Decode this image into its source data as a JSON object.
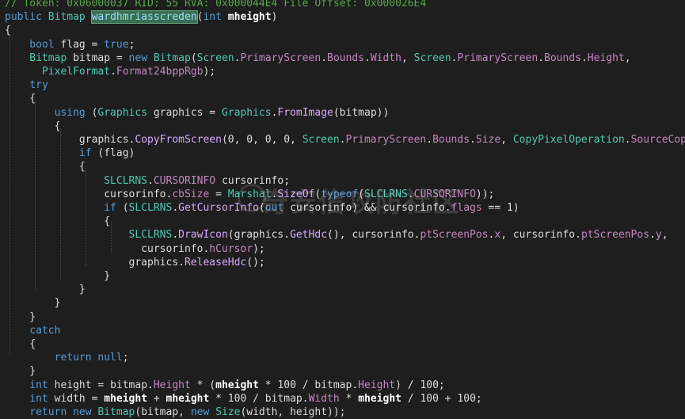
{
  "editor": {
    "lines": [
      [
        {
          "t": "// Token: 0x06000037 RID: 55 RVA: 0x000044E4 File Offset: 0x000026E4",
          "c": "cm"
        }
      ],
      [
        {
          "t": "public ",
          "c": "kw"
        },
        {
          "t": "Bitmap ",
          "c": "ty"
        },
        {
          "t": "wardhmriasscreden",
          "c": "hl"
        },
        {
          "t": "(",
          "c": "pl"
        },
        {
          "t": "int ",
          "c": "kw"
        },
        {
          "t": "mheight",
          "c": "bd"
        },
        {
          "t": ")",
          "c": "pl"
        }
      ],
      [
        {
          "t": "{",
          "c": "pl"
        }
      ],
      [
        {
          "t": "    bool ",
          "c": "kw"
        },
        {
          "t": "flag = ",
          "c": "pl"
        },
        {
          "t": "true",
          "c": "kw"
        },
        {
          "t": ";",
          "c": "pl"
        }
      ],
      [
        {
          "t": "    Bitmap ",
          "c": "ty"
        },
        {
          "t": "bitmap = ",
          "c": "pl"
        },
        {
          "t": "new ",
          "c": "kw"
        },
        {
          "t": "Bitmap",
          "c": "ty"
        },
        {
          "t": "(",
          "c": "pl"
        },
        {
          "t": "Screen",
          "c": "ty"
        },
        {
          "t": ".",
          "c": "pl"
        },
        {
          "t": "PrimaryScreen",
          "c": "pr"
        },
        {
          "t": ".",
          "c": "pl"
        },
        {
          "t": "Bounds",
          "c": "pr"
        },
        {
          "t": ".",
          "c": "pl"
        },
        {
          "t": "Width",
          "c": "pr"
        },
        {
          "t": ", ",
          "c": "pl"
        },
        {
          "t": "Screen",
          "c": "ty"
        },
        {
          "t": ".",
          "c": "pl"
        },
        {
          "t": "PrimaryScreen",
          "c": "pr"
        },
        {
          "t": ".",
          "c": "pl"
        },
        {
          "t": "Bounds",
          "c": "pr"
        },
        {
          "t": ".",
          "c": "pl"
        },
        {
          "t": "Height",
          "c": "pr"
        },
        {
          "t": ",",
          "c": "pl"
        }
      ],
      [
        {
          "t": "      PixelFormat",
          "c": "ty"
        },
        {
          "t": ".",
          "c": "pl"
        },
        {
          "t": "Format24bppRgb",
          "c": "pr"
        },
        {
          "t": ");",
          "c": "pl"
        }
      ],
      [
        {
          "t": "    try",
          "c": "kw"
        }
      ],
      [
        {
          "t": "    {",
          "c": "pl"
        }
      ],
      [
        {
          "t": "        using ",
          "c": "kw"
        },
        {
          "t": "(",
          "c": "pl"
        },
        {
          "t": "Graphics ",
          "c": "ty"
        },
        {
          "t": "graphics = ",
          "c": "pl"
        },
        {
          "t": "Graphics",
          "c": "ty"
        },
        {
          "t": ".",
          "c": "pl"
        },
        {
          "t": "FromImage",
          "c": "mt"
        },
        {
          "t": "(bitmap))",
          "c": "pl"
        }
      ],
      [
        {
          "t": "        {",
          "c": "pl"
        }
      ],
      [
        {
          "t": "            graphics.",
          "c": "pl"
        },
        {
          "t": "CopyFromScreen",
          "c": "mt"
        },
        {
          "t": "(0, 0, 0, 0, ",
          "c": "pl"
        },
        {
          "t": "Screen",
          "c": "ty"
        },
        {
          "t": ".",
          "c": "pl"
        },
        {
          "t": "PrimaryScreen",
          "c": "pr"
        },
        {
          "t": ".",
          "c": "pl"
        },
        {
          "t": "Bounds",
          "c": "pr"
        },
        {
          "t": ".",
          "c": "pl"
        },
        {
          "t": "Size",
          "c": "pr"
        },
        {
          "t": ", ",
          "c": "pl"
        },
        {
          "t": "CopyPixelOperation",
          "c": "ty"
        },
        {
          "t": ".",
          "c": "pl"
        },
        {
          "t": "SourceCopy",
          "c": "pr"
        },
        {
          "t": ");",
          "c": "pl"
        }
      ],
      [
        {
          "t": "            if ",
          "c": "kw"
        },
        {
          "t": "(flag)",
          "c": "pl"
        }
      ],
      [
        {
          "t": "            {",
          "c": "pl"
        }
      ],
      [
        {
          "t": "                SLCLRNS",
          "c": "ty"
        },
        {
          "t": ".",
          "c": "pl"
        },
        {
          "t": "CURSORINFO ",
          "c": "pr"
        },
        {
          "t": "cursorinfo;",
          "c": "pl"
        }
      ],
      [
        {
          "t": "                cursorinfo.",
          "c": "pl"
        },
        {
          "t": "cbSize",
          "c": "pr"
        },
        {
          "t": " = ",
          "c": "pl"
        },
        {
          "t": "Marshal",
          "c": "ty"
        },
        {
          "t": ".",
          "c": "pl"
        },
        {
          "t": "SizeOf",
          "c": "mt"
        },
        {
          "t": "(",
          "c": "pl"
        },
        {
          "t": "typeof",
          "c": "kw"
        },
        {
          "t": "(",
          "c": "pl"
        },
        {
          "t": "SLCLRNS",
          "c": "ty"
        },
        {
          "t": ".",
          "c": "pl"
        },
        {
          "t": "CURSORINFO",
          "c": "pr"
        },
        {
          "t": "));",
          "c": "pl"
        }
      ],
      [
        {
          "t": "                if ",
          "c": "kw"
        },
        {
          "t": "(",
          "c": "pl"
        },
        {
          "t": "SLCLRNS",
          "c": "ty"
        },
        {
          "t": ".",
          "c": "pl"
        },
        {
          "t": "GetCursorInfo",
          "c": "mt"
        },
        {
          "t": "(",
          "c": "pl"
        },
        {
          "t": "out ",
          "c": "kw"
        },
        {
          "t": "cursorinfo) && cursorinfo.",
          "c": "pl"
        },
        {
          "t": "flags",
          "c": "pr"
        },
        {
          "t": " == 1)",
          "c": "pl"
        }
      ],
      [
        {
          "t": "                {",
          "c": "pl"
        }
      ],
      [
        {
          "t": "                    SLCLRNS",
          "c": "ty"
        },
        {
          "t": ".",
          "c": "pl"
        },
        {
          "t": "DrawIcon",
          "c": "mt"
        },
        {
          "t": "(graphics.",
          "c": "pl"
        },
        {
          "t": "GetHdc",
          "c": "mt"
        },
        {
          "t": "(), cursorinfo.",
          "c": "pl"
        },
        {
          "t": "ptScreenPos",
          "c": "pr"
        },
        {
          "t": ".",
          "c": "pl"
        },
        {
          "t": "x",
          "c": "pr"
        },
        {
          "t": ", cursorinfo.",
          "c": "pl"
        },
        {
          "t": "ptScreenPos",
          "c": "pr"
        },
        {
          "t": ".",
          "c": "pl"
        },
        {
          "t": "y",
          "c": "pr"
        },
        {
          "t": ",",
          "c": "pl"
        }
      ],
      [
        {
          "t": "                      cursorinfo.",
          "c": "pl"
        },
        {
          "t": "hCursor",
          "c": "pr"
        },
        {
          "t": ");",
          "c": "pl"
        }
      ],
      [
        {
          "t": "                    graphics.",
          "c": "pl"
        },
        {
          "t": "ReleaseHdc",
          "c": "mt"
        },
        {
          "t": "();",
          "c": "pl"
        }
      ],
      [
        {
          "t": "                }",
          "c": "pl"
        }
      ],
      [
        {
          "t": "            }",
          "c": "pl"
        }
      ],
      [
        {
          "t": "        }",
          "c": "pl"
        }
      ],
      [
        {
          "t": "    }",
          "c": "pl"
        }
      ],
      [
        {
          "t": "    catch",
          "c": "kw"
        }
      ],
      [
        {
          "t": "    {",
          "c": "pl"
        }
      ],
      [
        {
          "t": "        return null",
          "c": "kw"
        },
        {
          "t": ";",
          "c": "pl"
        }
      ],
      [
        {
          "t": "    }",
          "c": "pl"
        }
      ],
      [
        {
          "t": "    int ",
          "c": "kw"
        },
        {
          "t": "height = bitmap.",
          "c": "pl"
        },
        {
          "t": "Height",
          "c": "pr"
        },
        {
          "t": " * (",
          "c": "pl"
        },
        {
          "t": "mheight",
          "c": "bd"
        },
        {
          "t": " * 100 / bitmap.",
          "c": "pl"
        },
        {
          "t": "Height",
          "c": "pr"
        },
        {
          "t": ") / 100;",
          "c": "pl"
        }
      ],
      [
        {
          "t": "    int ",
          "c": "kw"
        },
        {
          "t": "width = ",
          "c": "pl"
        },
        {
          "t": "mheight",
          "c": "bd"
        },
        {
          "t": " + ",
          "c": "pl"
        },
        {
          "t": "mheight",
          "c": "bd"
        },
        {
          "t": " * 100 / bitmap.",
          "c": "pl"
        },
        {
          "t": "Width",
          "c": "pr"
        },
        {
          "t": " * ",
          "c": "pl"
        },
        {
          "t": "mheight",
          "c": "bd"
        },
        {
          "t": " / 100 + 100;",
          "c": "pl"
        }
      ],
      [
        {
          "t": "    return new ",
          "c": "kw"
        },
        {
          "t": "Bitmap",
          "c": "ty"
        },
        {
          "t": "(bitmap, ",
          "c": "pl"
        },
        {
          "t": "new ",
          "c": "kw"
        },
        {
          "t": "Size",
          "c": "ty"
        },
        {
          "t": "(width, height));",
          "c": "pl"
        }
      ]
    ]
  },
  "watermark": {
    "text": "奇安信攻防社区",
    "icon": "shield-logo-icon"
  },
  "colors": {
    "background": "#1e1e1e",
    "keyword": "#569cd6",
    "type": "#4ec9b0",
    "member": "#c586c0",
    "method": "#d7a8ff",
    "comment": "#57a64a",
    "highlight": "#3a6f53"
  }
}
